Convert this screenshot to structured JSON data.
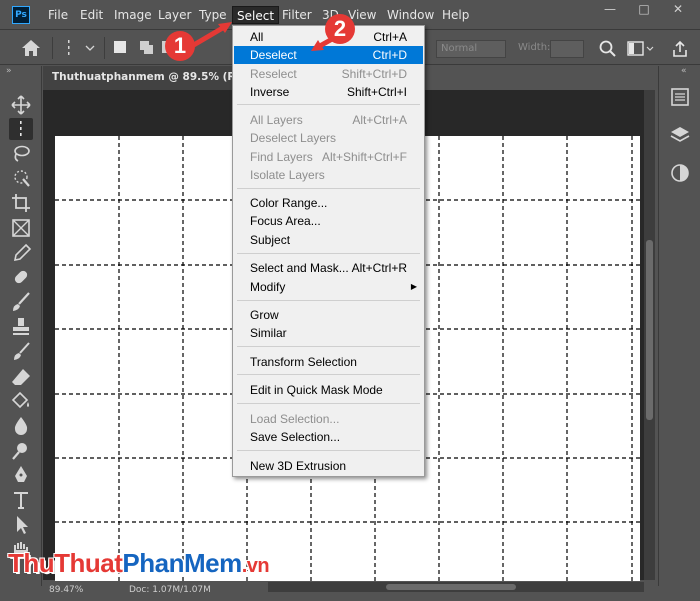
{
  "app": {
    "logo": "Ps",
    "accent": "#31a8ff"
  },
  "menubar": {
    "items": [
      {
        "label": "File"
      },
      {
        "label": "Edit"
      },
      {
        "label": "Image"
      },
      {
        "label": "Layer"
      },
      {
        "label": "Type"
      },
      {
        "label": "Select"
      },
      {
        "label": "Filter"
      },
      {
        "label": "3D"
      },
      {
        "label": "View"
      },
      {
        "label": "Window"
      },
      {
        "label": "Help"
      }
    ],
    "window_buttons": {
      "minimize": "—",
      "maximize": "□",
      "close": "✕"
    }
  },
  "options_bar": {
    "style_value": "Normal",
    "width_label": "Width:"
  },
  "document": {
    "tab_title": "Thuthuatphanmem @ 89.5% (RGB/8",
    "status_zoom": "89.47%",
    "status_doc": "Doc: 1.07M/1.07M"
  },
  "select_menu": {
    "items": [
      {
        "label": "All",
        "shortcut": "Ctrl+A",
        "state": "normal"
      },
      {
        "label": "Deselect",
        "shortcut": "Ctrl+D",
        "state": "highlight"
      },
      {
        "label": "Reselect",
        "shortcut": "Shift+Ctrl+D",
        "state": "disabled"
      },
      {
        "label": "Inverse",
        "shortcut": "Shift+Ctrl+I",
        "state": "normal"
      },
      {
        "label": "All Layers",
        "shortcut": "Alt+Ctrl+A",
        "state": "disabled"
      },
      {
        "label": "Deselect Layers",
        "shortcut": "",
        "state": "disabled"
      },
      {
        "label": "Find Layers",
        "shortcut": "Alt+Shift+Ctrl+F",
        "state": "disabled"
      },
      {
        "label": "Isolate Layers",
        "shortcut": "",
        "state": "disabled"
      },
      {
        "label": "Color Range...",
        "shortcut": "",
        "state": "normal"
      },
      {
        "label": "Focus Area...",
        "shortcut": "",
        "state": "normal"
      },
      {
        "label": "Subject",
        "shortcut": "",
        "state": "normal"
      },
      {
        "label": "Select and Mask...",
        "shortcut": "Alt+Ctrl+R",
        "state": "normal"
      },
      {
        "label": "Modify",
        "shortcut": "",
        "state": "submenu"
      },
      {
        "label": "Grow",
        "shortcut": "",
        "state": "normal"
      },
      {
        "label": "Similar",
        "shortcut": "",
        "state": "normal"
      },
      {
        "label": "Transform Selection",
        "shortcut": "",
        "state": "normal"
      },
      {
        "label": "Edit in Quick Mask Mode",
        "shortcut": "",
        "state": "normal"
      },
      {
        "label": "Load Selection...",
        "shortcut": "",
        "state": "disabled"
      },
      {
        "label": "Save Selection...",
        "shortcut": "",
        "state": "normal"
      },
      {
        "label": "New 3D Extrusion",
        "shortcut": "",
        "state": "normal"
      }
    ],
    "highlight_color": "#0078d7"
  },
  "annotations": {
    "step1": "1",
    "step2": "2",
    "color": "#e53935"
  },
  "watermark": {
    "part1": "Thu",
    "part2": "Thuat",
    "part3": "Phan",
    "part4": "Mem",
    "part5": ".vn"
  }
}
